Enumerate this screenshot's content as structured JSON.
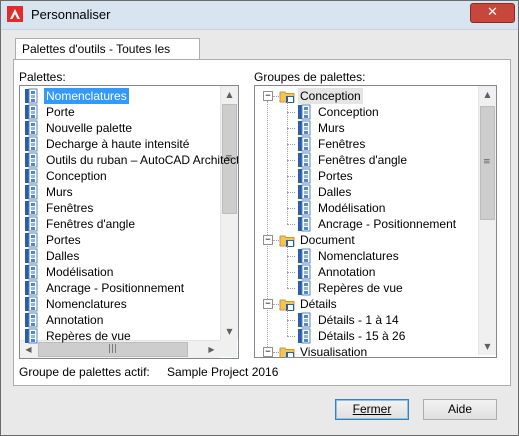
{
  "window": {
    "title": "Personnaliser",
    "close_label": "✕"
  },
  "tab": {
    "label": "Palettes d'outils - Toutes les palettes"
  },
  "palettes": {
    "label": "Palettes:",
    "items": [
      "Nomenclatures",
      "Porte",
      "Nouvelle palette",
      "Decharge à haute intensité",
      "Outils du ruban – AutoCAD Architecture",
      "Conception",
      "Murs",
      "Fenêtres",
      "Fenêtres d'angle",
      "Portes",
      "Dalles",
      "Modélisation",
      "Ancrage - Positionnement",
      "Nomenclatures",
      "Annotation",
      "Repères de vue"
    ],
    "selected_index": 0
  },
  "groups": {
    "label": "Groupes de palettes:",
    "tree": [
      {
        "label": "Conception",
        "children": [
          "Conception",
          "Murs",
          "Fenêtres",
          "Fenêtres d'angle",
          "Portes",
          "Dalles",
          "Modélisation",
          "Ancrage - Positionnement"
        ]
      },
      {
        "label": "Document",
        "children": [
          "Nomenclatures",
          "Annotation",
          "Repères de vue"
        ]
      },
      {
        "label": "Détails",
        "children": [
          "Détails - 1 à 14",
          "Détails - 15 à 26"
        ]
      },
      {
        "label": "Visualisation",
        "children": []
      }
    ]
  },
  "active_group": {
    "label": "Groupe de palettes actif:",
    "value": "Sample Project 2016"
  },
  "buttons": {
    "close": "Fermer",
    "help": "Aide"
  },
  "colors": {
    "selection": "#3399ff",
    "close_button": "#c7473a",
    "titlebar": "#d9e4f1"
  }
}
